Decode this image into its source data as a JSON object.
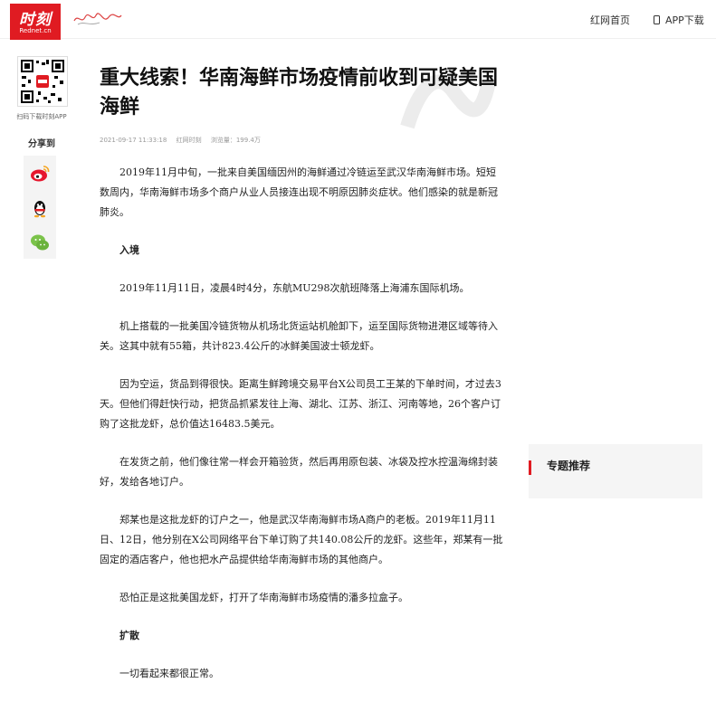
{
  "header": {
    "logo_text": "时刻",
    "logo_sub": "Rednet.cn",
    "nav_home": "红网首页",
    "nav_app": "APP下载"
  },
  "sidebar": {
    "qr_caption": "扫码下载时刻APP",
    "share_title": "分享到",
    "share_icons": [
      "weibo-icon",
      "qq-icon",
      "wechat-icon"
    ]
  },
  "article": {
    "title": "重大线索！华南海鲜市场疫情前收到可疑美国海鲜",
    "meta": {
      "time": "2021-09-17 11:33:18",
      "source": "红网时刻",
      "views": "浏览量：199.4万"
    },
    "paragraphs": [
      {
        "type": "p",
        "text": "2019年11月中旬，一批来自美国缅因州的海鲜通过冷链运至武汉华南海鲜市场。短短数周内，华南海鲜市场多个商户从业人员接连出现不明原因肺炎症状。他们感染的就是新冠肺炎。"
      },
      {
        "type": "heading",
        "text": "入境"
      },
      {
        "type": "p",
        "text": "2019年11月11日，凌晨4时4分，东航MU298次航班降落上海浦东国际机场。"
      },
      {
        "type": "p",
        "text": "机上搭载的一批美国冷链货物从机场北货运站机舱卸下，运至国际货物进港区域等待入关。这其中就有55箱，共计823.4公斤的冰鲜美国波士顿龙虾。"
      },
      {
        "type": "p",
        "text": "因为空运，货品到得很快。距离生鲜跨境交易平台X公司员工王某的下单时间，才过去3天。但他们得赶快行动，把货品抓紧发往上海、湖北、江苏、浙江、河南等地，26个客户订购了这批龙虾，总价值达16483.5美元。"
      },
      {
        "type": "p",
        "text": "在发货之前，他们像往常一样会开箱验货，然后再用原包装、冰袋及控水控温海绵封装好，发给各地订户。"
      },
      {
        "type": "p",
        "text": "郑某也是这批龙虾的订户之一，他是武汉华南海鲜市场A商户的老板。2019年11月11日、12日，他分别在X公司网络平台下单订购了共140.08公斤的龙虾。这些年，郑某有一批固定的酒店客户，他也把水产品提供给华南海鲜市场的其他商户。"
      },
      {
        "type": "p",
        "text": "恐怕正是这批美国龙虾，打开了华南海鲜市场疫情的潘多拉盒子。"
      },
      {
        "type": "heading",
        "text": "扩散"
      },
      {
        "type": "p",
        "text": "一切看起来都很正常。"
      }
    ]
  },
  "right": {
    "topic_title": "专题推荐"
  },
  "colors": {
    "brand_red": "#e01b22",
    "panel_gray": "#f5f5f5"
  }
}
